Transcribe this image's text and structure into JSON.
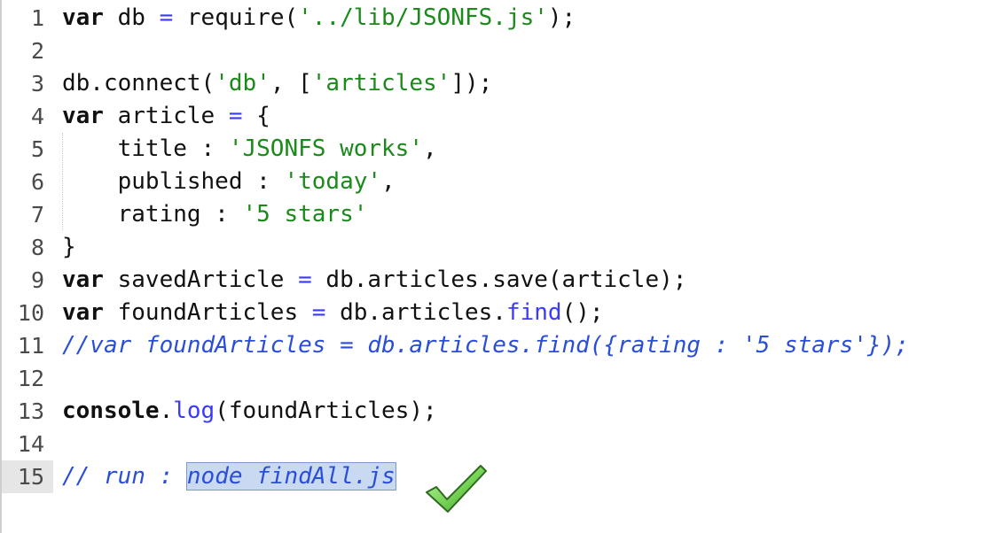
{
  "editor": {
    "lines": [
      {
        "num": "1",
        "tokens": [
          {
            "t": "var",
            "c": "kw"
          },
          {
            "t": " db ",
            "c": ""
          },
          {
            "t": "=",
            "c": "op"
          },
          {
            "t": " require(",
            "c": ""
          },
          {
            "t": "'../lib/JSONFS.js'",
            "c": "str"
          },
          {
            "t": ");",
            "c": ""
          }
        ]
      },
      {
        "num": "2",
        "tokens": []
      },
      {
        "num": "3",
        "tokens": [
          {
            "t": "db.connect(",
            "c": ""
          },
          {
            "t": "'db'",
            "c": "str"
          },
          {
            "t": ", [",
            "c": ""
          },
          {
            "t": "'articles'",
            "c": "str"
          },
          {
            "t": "]);",
            "c": ""
          }
        ]
      },
      {
        "num": "4",
        "tokens": [
          {
            "t": "var",
            "c": "kw"
          },
          {
            "t": " article ",
            "c": ""
          },
          {
            "t": "=",
            "c": "op"
          },
          {
            "t": " {",
            "c": ""
          }
        ]
      },
      {
        "num": "5",
        "tokens": [
          {
            "t": "    title : ",
            "c": ""
          },
          {
            "t": "'JSONFS works'",
            "c": "str"
          },
          {
            "t": ",",
            "c": ""
          }
        ]
      },
      {
        "num": "6",
        "tokens": [
          {
            "t": "    published : ",
            "c": ""
          },
          {
            "t": "'today'",
            "c": "str"
          },
          {
            "t": ",",
            "c": ""
          }
        ]
      },
      {
        "num": "7",
        "tokens": [
          {
            "t": "    rating : ",
            "c": ""
          },
          {
            "t": "'5 stars'",
            "c": "str"
          }
        ]
      },
      {
        "num": "8",
        "tokens": [
          {
            "t": "}",
            "c": ""
          }
        ]
      },
      {
        "num": "9",
        "tokens": [
          {
            "t": "var",
            "c": "kw"
          },
          {
            "t": " savedArticle ",
            "c": ""
          },
          {
            "t": "=",
            "c": "op"
          },
          {
            "t": " db.articles.save(article);",
            "c": ""
          }
        ]
      },
      {
        "num": "10",
        "tokens": [
          {
            "t": "var",
            "c": "kw"
          },
          {
            "t": " foundArticles ",
            "c": ""
          },
          {
            "t": "=",
            "c": "op"
          },
          {
            "t": " db.articles.",
            "c": ""
          },
          {
            "t": "find",
            "c": "fn"
          },
          {
            "t": "();",
            "c": ""
          }
        ]
      },
      {
        "num": "11",
        "tokens": [
          {
            "t": "//var foundArticles = db.articles.find({rating : '5 stars'});",
            "c": "cm"
          }
        ]
      },
      {
        "num": "12",
        "tokens": []
      },
      {
        "num": "13",
        "tokens": [
          {
            "t": "console",
            "c": "kw"
          },
          {
            "t": ".",
            "c": ""
          },
          {
            "t": "log",
            "c": "fn"
          },
          {
            "t": "(foundArticles);",
            "c": ""
          }
        ]
      },
      {
        "num": "14",
        "tokens": []
      },
      {
        "num": "15",
        "tokens": [
          {
            "t": "// run : ",
            "c": "cm"
          },
          {
            "t": "node findAll.js",
            "c": "sel"
          }
        ]
      }
    ],
    "current_line": "15",
    "colors": {
      "keyword": "#111111",
      "operator": "#3a3aff",
      "string": "#1a8a1a",
      "comment": "#2a4fd6",
      "selection": "#c9d9f2",
      "checkmark": "#7bd65a"
    },
    "overlay_icon": "checkmark-icon"
  }
}
